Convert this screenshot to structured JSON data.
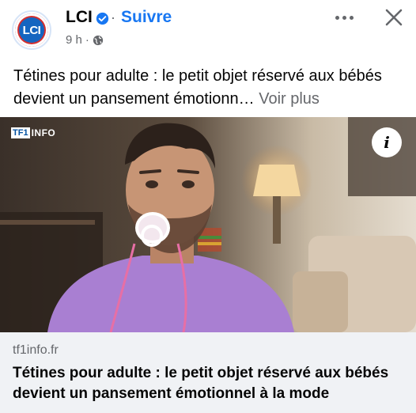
{
  "post": {
    "page_name": "LCI",
    "avatar_text": "LCI",
    "follow_label": "Suivre",
    "separator": "·",
    "time": "9 h",
    "meta_dot": "·",
    "caption_text": "Tétines pour adulte : le petit objet réservé aux bébés devient un pansement émotionn…",
    "see_more_label": "Voir plus"
  },
  "media": {
    "watermark_box": "TF1",
    "watermark_text": "INFO",
    "info_glyph": "i"
  },
  "link": {
    "domain": "tf1info.fr",
    "title": "Tétines pour adulte : le petit objet réservé aux bébés devient un pansement émotionnel à la mode"
  },
  "colors": {
    "accent": "#1877f2",
    "secondary_text": "#65676b",
    "card_bg": "#f0f2f5"
  },
  "icons": [
    "verified-badge-icon",
    "globe-icon",
    "more-options-icon",
    "close-icon",
    "info-icon"
  ]
}
